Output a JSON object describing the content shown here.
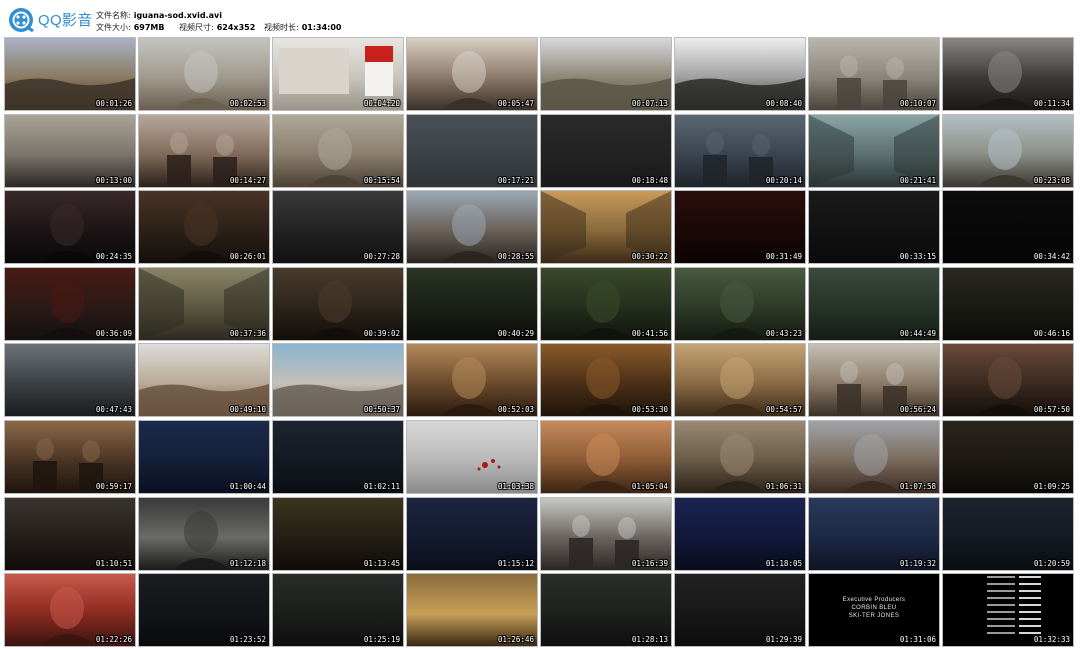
{
  "header": {
    "brand": "QQ影音",
    "file_name_label": "文件名称:",
    "file_name": "iguana-sod.xvid.avi",
    "file_size_label": "文件大小:",
    "file_size": "697MB",
    "dimensions_label": "视频尺寸:",
    "dimensions": "624x352",
    "duration_label": "视频时长:",
    "duration": "01:34:00"
  },
  "credits": {
    "heading": "Executive Producers",
    "names": [
      "CORBIN BLEU",
      "SKI-TER JONES"
    ]
  },
  "thumbnails": [
    {
      "time": "00:01:26",
      "scene": "desert-road"
    },
    {
      "time": "00:02:53",
      "scene": "man-laughing"
    },
    {
      "time": "00:04:20",
      "scene": "marlboro-sign"
    },
    {
      "time": "00:05:47",
      "scene": "bearded-man"
    },
    {
      "time": "00:07:13",
      "scene": "desert-hills"
    },
    {
      "time": "00:08:40",
      "scene": "sky-trees"
    },
    {
      "time": "00:10:07",
      "scene": "group-desert"
    },
    {
      "time": "00:11:34",
      "scene": "woman-hair"
    },
    {
      "time": "00:13:00",
      "scene": "woman-sand"
    },
    {
      "time": "00:14:27",
      "scene": "couple-closeup"
    },
    {
      "time": "00:15:54",
      "scene": "man-vest"
    },
    {
      "time": "00:17:21",
      "scene": "grey-sky"
    },
    {
      "time": "00:18:48",
      "scene": "dark"
    },
    {
      "time": "00:20:14",
      "scene": "man-smoking-street"
    },
    {
      "time": "00:21:41",
      "scene": "hallway"
    },
    {
      "time": "00:23:08",
      "scene": "man-mall"
    },
    {
      "time": "00:24:35",
      "scene": "woman-night"
    },
    {
      "time": "00:26:01",
      "scene": "man-desk"
    },
    {
      "time": "00:27:28",
      "scene": "dark-hand"
    },
    {
      "time": "00:28:55",
      "scene": "man-street"
    },
    {
      "time": "00:30:22",
      "scene": "building"
    },
    {
      "time": "00:31:49",
      "scene": "dark-red"
    },
    {
      "time": "00:33:15",
      "scene": "dark-figure"
    },
    {
      "time": "00:34:42",
      "scene": "black"
    },
    {
      "time": "00:36:09",
      "scene": "man-car"
    },
    {
      "time": "00:37:36",
      "scene": "bathroom"
    },
    {
      "time": "00:39:02",
      "scene": "man-lighter"
    },
    {
      "time": "00:40:29",
      "scene": "car-night"
    },
    {
      "time": "00:41:56",
      "scene": "car-interior"
    },
    {
      "time": "00:43:23",
      "scene": "car-driver"
    },
    {
      "time": "00:44:49",
      "scene": "green-dark"
    },
    {
      "time": "00:46:16",
      "scene": "street-night"
    },
    {
      "time": "00:47:43",
      "scene": "cave"
    },
    {
      "time": "00:49:10",
      "scene": "woman-beach"
    },
    {
      "time": "00:50:37",
      "scene": "car-palms"
    },
    {
      "time": "00:52:03",
      "scene": "woman-room"
    },
    {
      "time": "00:53:30",
      "scene": "woman-door"
    },
    {
      "time": "00:54:57",
      "scene": "woman-blinds"
    },
    {
      "time": "00:56:24",
      "scene": "man-fence"
    },
    {
      "time": "00:57:50",
      "scene": "man-bed"
    },
    {
      "time": "00:59:17",
      "scene": "two-men-table"
    },
    {
      "time": "01:00:44",
      "scene": "blue-room"
    },
    {
      "time": "01:02:11",
      "scene": "dark-blue"
    },
    {
      "time": "01:03:38",
      "scene": "sink-blood"
    },
    {
      "time": "01:05:04",
      "scene": "shirtless-man"
    },
    {
      "time": "01:06:31",
      "scene": "man-chair"
    },
    {
      "time": "01:07:58",
      "scene": "woman-car"
    },
    {
      "time": "01:09:25",
      "scene": "dark-room"
    },
    {
      "time": "01:10:51",
      "scene": "dark-doorway"
    },
    {
      "time": "01:12:18",
      "scene": "creature"
    },
    {
      "time": "01:13:45",
      "scene": "dark-face"
    },
    {
      "time": "01:15:12",
      "scene": "dark-blue2"
    },
    {
      "time": "01:16:39",
      "scene": "two-women-sign"
    },
    {
      "time": "01:18:05",
      "scene": "blue-figure"
    },
    {
      "time": "01:19:32",
      "scene": "blue-smoke"
    },
    {
      "time": "01:20:59",
      "scene": "dark-smoke"
    },
    {
      "time": "01:22:26",
      "scene": "bloody-face"
    },
    {
      "time": "01:23:52",
      "scene": "city-night"
    },
    {
      "time": "01:25:19",
      "scene": "dark-ground"
    },
    {
      "time": "01:26:46",
      "scene": "woman-walking"
    },
    {
      "time": "01:28:13",
      "scene": "dark-house"
    },
    {
      "time": "01:29:39",
      "scene": "dark-legs"
    },
    {
      "time": "01:31:06",
      "scene": "credits-exec"
    },
    {
      "time": "01:32:33",
      "scene": "credits-list"
    }
  ],
  "colors": {
    "brand": "#2f8fd0",
    "frame_border": "#bbbbbb"
  }
}
